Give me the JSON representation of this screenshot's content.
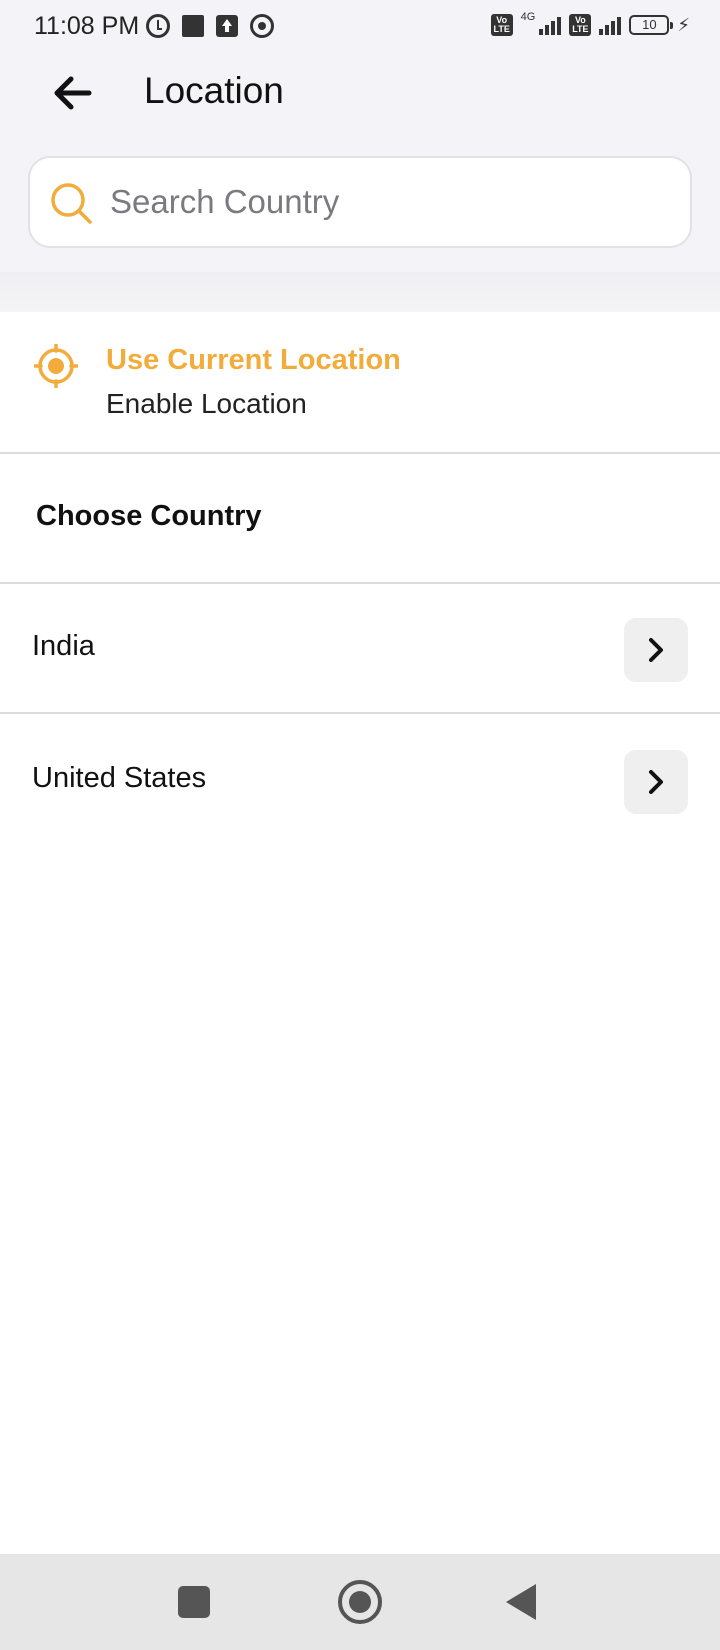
{
  "status_bar": {
    "time": "11:08 PM",
    "network_label": "4G",
    "volte_label": "Vo LTE",
    "battery_level": "10",
    "icons": [
      "alarm-icon",
      "stop-icon",
      "upload-icon",
      "chrome-icon",
      "volte-icon",
      "signal-icon",
      "battery-icon",
      "charging-icon"
    ]
  },
  "header": {
    "title": "Location",
    "back_icon": "arrow-left-icon"
  },
  "search": {
    "placeholder": "Search Country",
    "value": "",
    "icon": "search-icon"
  },
  "current_location": {
    "title": "Use Current Location",
    "subtitle": "Enable Location",
    "icon": "crosshair-target-icon"
  },
  "country_section": {
    "heading": "Choose Country",
    "items": [
      {
        "label": "India",
        "icon": "chevron-right-icon"
      },
      {
        "label": "United States",
        "icon": "chevron-right-icon"
      }
    ]
  },
  "colors": {
    "accent": "#f2ac3c",
    "header_bg": "#f3f3f8",
    "divider": "#dcdcdc",
    "nav_bg": "#e6e6e6"
  },
  "nav_bar": {
    "icons": [
      "recent-apps-icon",
      "home-icon",
      "back-triangle-icon"
    ]
  }
}
